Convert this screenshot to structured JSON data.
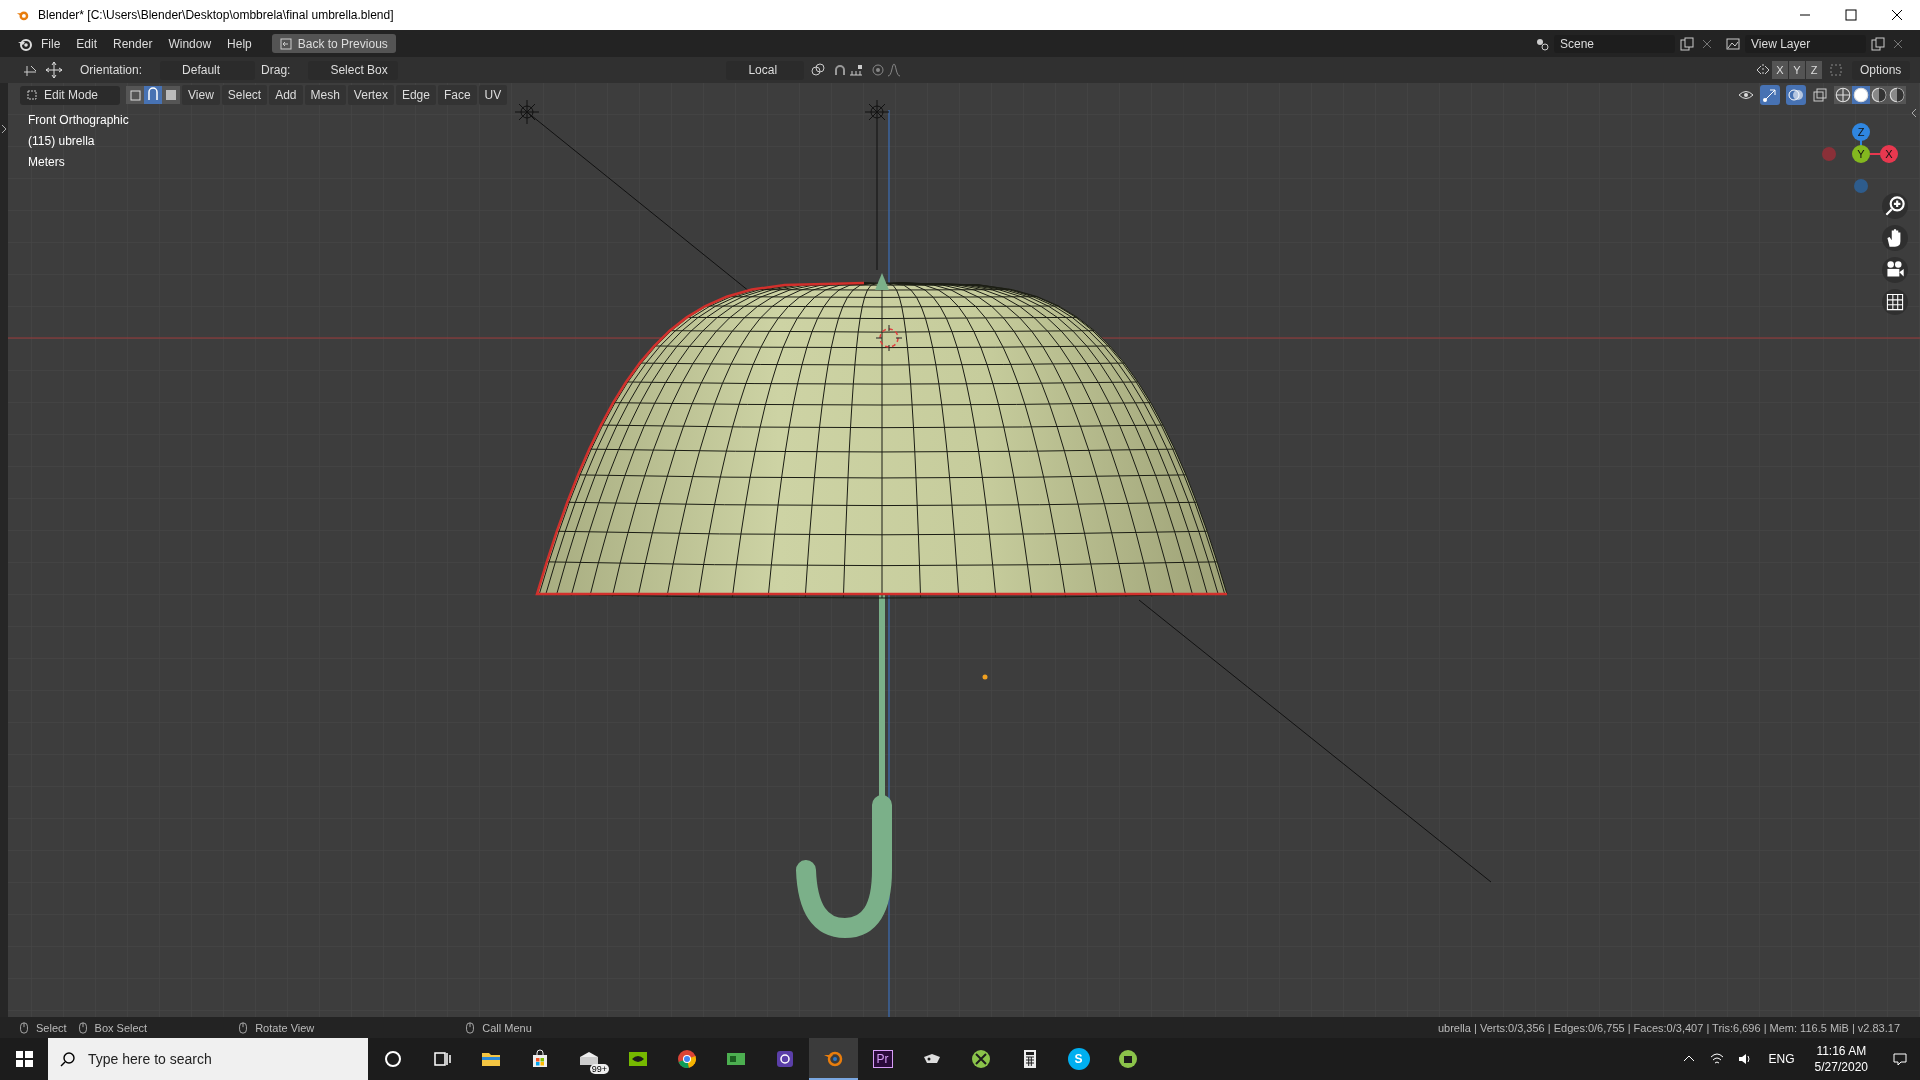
{
  "window": {
    "title": "Blender* [C:\\Users\\Blender\\Desktop\\ombbrela\\final umbrella.blend]"
  },
  "menu": [
    "File",
    "Edit",
    "Render",
    "Window",
    "Help"
  ],
  "back_button": "Back to Previous",
  "scene": "Scene",
  "view_layer": "View Layer",
  "tool_header": {
    "orientation_label": "Orientation:",
    "orientation": "Default",
    "drag_label": "Drag:",
    "drag": "Select Box",
    "pivot": "Local",
    "axes": [
      "X",
      "Y",
      "Z"
    ],
    "options": "Options"
  },
  "viewport_header": {
    "mode": "Edit Mode",
    "select_modes": [
      {
        "selected": false
      },
      {
        "selected": true
      },
      {
        "selected": false
      }
    ],
    "menus": [
      "View",
      "Select",
      "Add",
      "Mesh",
      "Vertex",
      "Edge",
      "Face",
      "UV"
    ],
    "shading": [
      {
        "selected": false
      },
      {
        "selected": true
      },
      {
        "selected": false
      },
      {
        "selected": false
      }
    ]
  },
  "overlay_text": [
    "Front Orthographic",
    "(115) ubrella",
    "Meters"
  ],
  "gizmo": {
    "axes": [
      {
        "label": "Z",
        "color": "#2f86e0"
      },
      {
        "label": "Y",
        "color": "#83b81f"
      },
      {
        "label": "X",
        "color": "#e8384f"
      }
    ]
  },
  "status_bar": {
    "hints": [
      "Select",
      "Box Select",
      "Rotate View",
      "Call Menu"
    ],
    "stats": "ubrella | Verts:0/3,356 | Edges:0/6,755 | Faces:0/3,407 | Tris:6,696 | Mem: 116.5 MiB | v2.83.17"
  },
  "taskbar": {
    "search_placeholder": "Type here to search",
    "apps": [
      {
        "kind": "cortana",
        "selected": false
      },
      {
        "kind": "taskview",
        "selected": false
      },
      {
        "kind": "folder",
        "selected": false
      },
      {
        "kind": "store",
        "selected": false
      },
      {
        "kind": "mail",
        "badge": "99+",
        "selected": false
      },
      {
        "kind": "nvidia",
        "selected": false
      },
      {
        "kind": "chrome",
        "selected": false
      },
      {
        "kind": "card",
        "selected": false
      },
      {
        "kind": "chip",
        "selected": false
      },
      {
        "kind": "blender",
        "selected": true
      },
      {
        "kind": "letters",
        "label": "Pr",
        "selected": false
      },
      {
        "kind": "gamepad",
        "selected": false
      },
      {
        "kind": "xbox",
        "selected": false
      },
      {
        "kind": "calculator",
        "selected": false
      },
      {
        "kind": "round",
        "label": "S",
        "selected": false
      },
      {
        "kind": "bag",
        "selected": false
      }
    ],
    "language": "ENG",
    "time": "11:16 AM",
    "date": "5/27/2020"
  }
}
